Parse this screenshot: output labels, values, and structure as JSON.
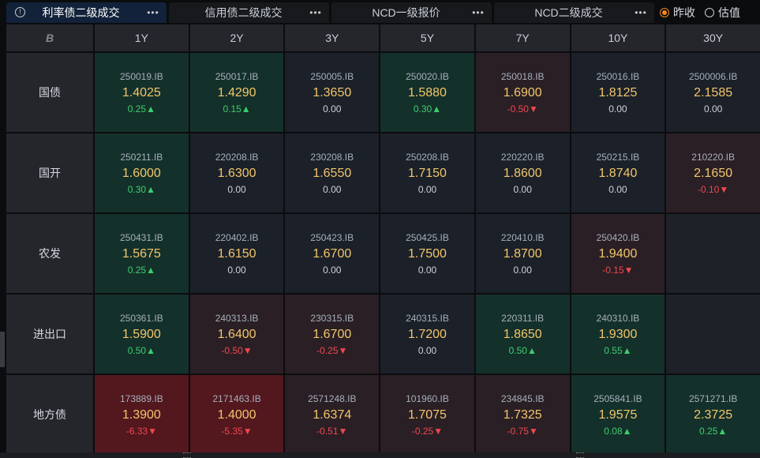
{
  "tabs": [
    {
      "label": "利率债二级成交",
      "active": true
    },
    {
      "label": "信用债二级成交",
      "active": false
    },
    {
      "label": "NCD一级报价",
      "active": false
    },
    {
      "label": "NCD二级成交",
      "active": false
    }
  ],
  "more_label": "•••",
  "info_icon": "!",
  "radios": [
    {
      "label": "昨收",
      "checked": true
    },
    {
      "label": "估值",
      "checked": false
    }
  ],
  "header": {
    "logo": "B",
    "columns": [
      "1Y",
      "2Y",
      "3Y",
      "5Y",
      "7Y",
      "10Y",
      "30Y"
    ]
  },
  "rows": [
    {
      "name": "国债",
      "cells": [
        {
          "code": "250019.IB",
          "value": "1.4025",
          "change": "0.25",
          "dir": "up",
          "tone": "up"
        },
        {
          "code": "250017.IB",
          "value": "1.4290",
          "change": "0.15",
          "dir": "up",
          "tone": "up"
        },
        {
          "code": "250005.IB",
          "value": "1.3650",
          "change": "0.00",
          "dir": "flat",
          "tone": "flat"
        },
        {
          "code": "250020.IB",
          "value": "1.5880",
          "change": "0.30",
          "dir": "up",
          "tone": "up"
        },
        {
          "code": "250018.IB",
          "value": "1.6900",
          "change": "-0.50",
          "dir": "down",
          "tone": "down"
        },
        {
          "code": "250016.IB",
          "value": "1.8125",
          "change": "0.00",
          "dir": "flat",
          "tone": "flat"
        },
        {
          "code": "2500006.IB",
          "value": "2.1585",
          "change": "0.00",
          "dir": "flat",
          "tone": "flat"
        }
      ]
    },
    {
      "name": "国开",
      "cells": [
        {
          "code": "250211.IB",
          "value": "1.6000",
          "change": "0.30",
          "dir": "up",
          "tone": "up"
        },
        {
          "code": "220208.IB",
          "value": "1.6300",
          "change": "0.00",
          "dir": "flat",
          "tone": "flat"
        },
        {
          "code": "230208.IB",
          "value": "1.6550",
          "change": "0.00",
          "dir": "flat",
          "tone": "flat"
        },
        {
          "code": "250208.IB",
          "value": "1.7150",
          "change": "0.00",
          "dir": "flat",
          "tone": "flat"
        },
        {
          "code": "220220.IB",
          "value": "1.8600",
          "change": "0.00",
          "dir": "flat",
          "tone": "flat"
        },
        {
          "code": "250215.IB",
          "value": "1.8740",
          "change": "0.00",
          "dir": "flat",
          "tone": "flat"
        },
        {
          "code": "210220.IB",
          "value": "2.1650",
          "change": "-0.10",
          "dir": "down",
          "tone": "down"
        }
      ]
    },
    {
      "name": "农发",
      "cells": [
        {
          "code": "250431.IB",
          "value": "1.5675",
          "change": "0.25",
          "dir": "up",
          "tone": "up"
        },
        {
          "code": "220402.IB",
          "value": "1.6150",
          "change": "0.00",
          "dir": "flat",
          "tone": "flat"
        },
        {
          "code": "250423.IB",
          "value": "1.6700",
          "change": "0.00",
          "dir": "flat",
          "tone": "flat"
        },
        {
          "code": "250425.IB",
          "value": "1.7500",
          "change": "0.00",
          "dir": "flat",
          "tone": "flat"
        },
        {
          "code": "220410.IB",
          "value": "1.8700",
          "change": "0.00",
          "dir": "flat",
          "tone": "flat"
        },
        {
          "code": "250420.IB",
          "value": "1.9400",
          "change": "-0.15",
          "dir": "down",
          "tone": "down"
        },
        null
      ]
    },
    {
      "name": "进出口",
      "cells": [
        {
          "code": "250361.IB",
          "value": "1.5900",
          "change": "0.50",
          "dir": "up",
          "tone": "up"
        },
        {
          "code": "240313.IB",
          "value": "1.6400",
          "change": "-0.50",
          "dir": "down",
          "tone": "down"
        },
        {
          "code": "230315.IB",
          "value": "1.6700",
          "change": "-0.25",
          "dir": "down",
          "tone": "down"
        },
        {
          "code": "240315.IB",
          "value": "1.7200",
          "change": "0.00",
          "dir": "flat",
          "tone": "flat"
        },
        {
          "code": "220311.IB",
          "value": "1.8650",
          "change": "0.50",
          "dir": "up",
          "tone": "up"
        },
        {
          "code": "240310.IB",
          "value": "1.9300",
          "change": "0.55",
          "dir": "up",
          "tone": "up"
        },
        null
      ]
    },
    {
      "name": "地方债",
      "cells": [
        {
          "code": "173889.IB",
          "value": "1.3900",
          "change": "-6.33",
          "dir": "down",
          "tone": "down-strong"
        },
        {
          "code": "2171463.IB",
          "value": "1.4000",
          "change": "-5.35",
          "dir": "down",
          "tone": "down-strong"
        },
        {
          "code": "2571248.IB",
          "value": "1.6374",
          "change": "-0.51",
          "dir": "down",
          "tone": "down"
        },
        {
          "code": "101960.IB",
          "value": "1.7075",
          "change": "-0.25",
          "dir": "down",
          "tone": "down"
        },
        {
          "code": "234845.IB",
          "value": "1.7325",
          "change": "-0.75",
          "dir": "down",
          "tone": "down"
        },
        {
          "code": "2505841.IB",
          "value": "1.9575",
          "change": "0.08",
          "dir": "up",
          "tone": "up"
        },
        {
          "code": "2571271.IB",
          "value": "2.3725",
          "change": "0.25",
          "dir": "up",
          "tone": "up"
        }
      ]
    }
  ]
}
